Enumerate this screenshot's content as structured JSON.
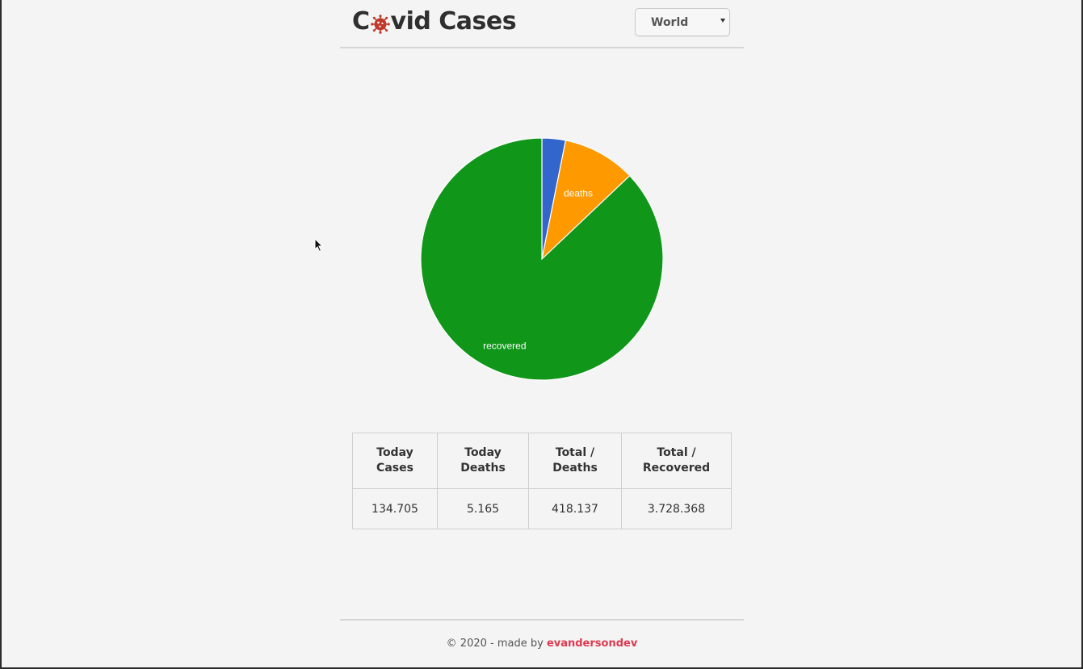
{
  "header": {
    "title_prefix": "C",
    "title_suffix": "vid Cases",
    "country_select": {
      "selected": "World"
    }
  },
  "chart_data": {
    "type": "pie",
    "title": "",
    "categories": [
      "",
      "deaths",
      "recovered"
    ],
    "values": [
      134705,
      418137,
      3728368
    ],
    "colors": [
      "#3366cc",
      "#ff9900",
      "#109618"
    ],
    "labels_shown": [
      "",
      "deaths",
      "recovered"
    ],
    "legend": "none"
  },
  "stats": {
    "headers": [
      [
        "Today",
        "Cases"
      ],
      [
        "Today",
        "Deaths"
      ],
      [
        "Total /",
        "Deaths"
      ],
      [
        "Total /",
        "Recovered"
      ]
    ],
    "values": [
      "134.705",
      "5.165",
      "418.137",
      "3.728.368"
    ]
  },
  "footer": {
    "text": "© 2020 - made by ",
    "author": "evandersondev"
  },
  "colors": {
    "background": "#f4f4f4",
    "accent": "#e0384f",
    "virus_icon": "#c0392b"
  }
}
